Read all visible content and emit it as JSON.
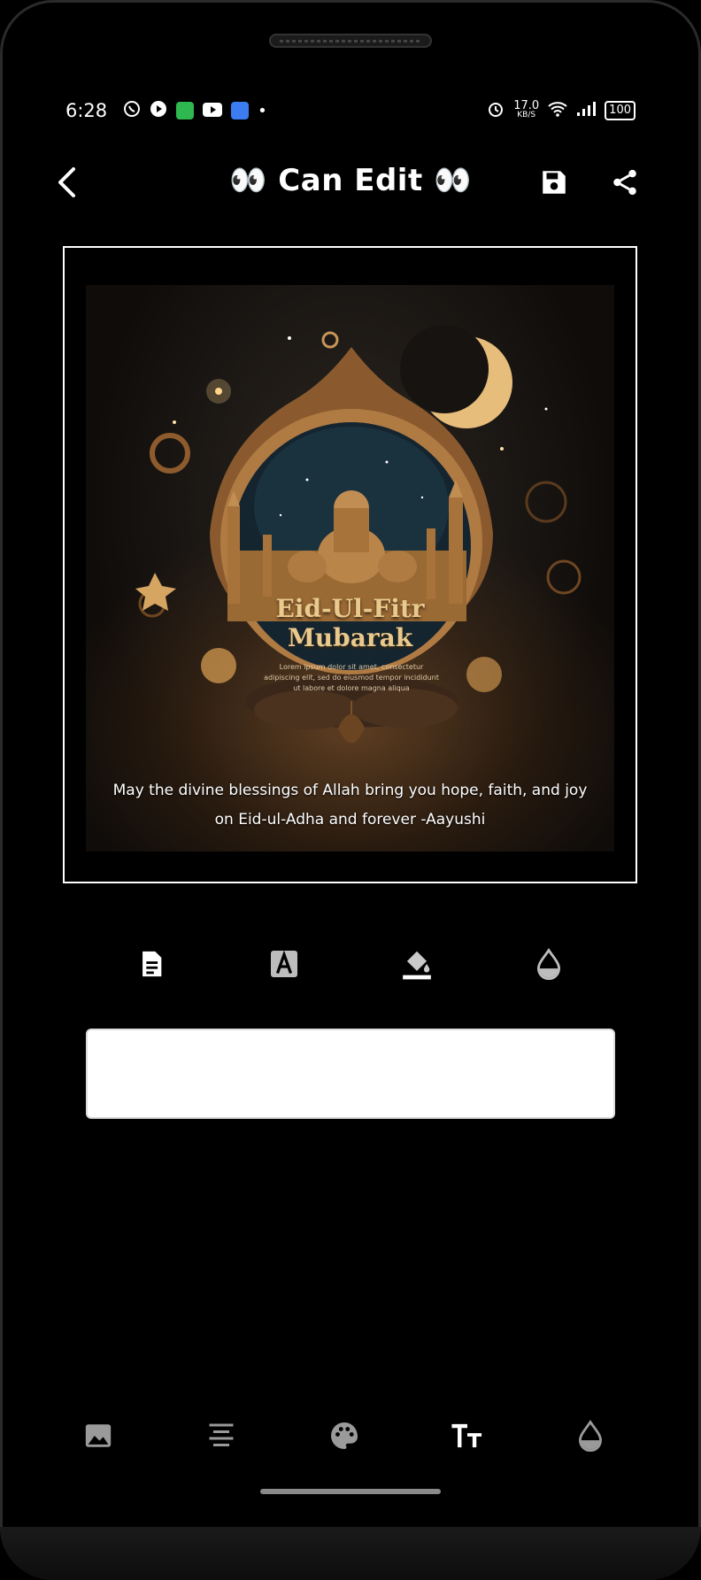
{
  "status_bar": {
    "time": "6:28",
    "net_speed_value": "17.0",
    "net_speed_unit": "KB/S",
    "battery": "100"
  },
  "app_bar": {
    "title": "👀 Can Edit 👀"
  },
  "poster": {
    "title_line1": "Eid-Ul-Fitr",
    "title_line2": "Mubarak",
    "lorem": "Lorem ipsum dolor sit amet, consectetur adipiscing elit, sed do eiusmod tempor incididunt ut labore et dolore magna aliqua",
    "message": "May the divine blessings of Allah bring you hope, faith, and joy on Eid-ul-Adha and forever -Aayushi"
  },
  "editor": {
    "text_input_value": ""
  },
  "colors": {
    "background": "#000000",
    "accent_gold": "#e9c98c",
    "icon_white": "#ffffff",
    "icon_gray": "#9a9a9a"
  }
}
